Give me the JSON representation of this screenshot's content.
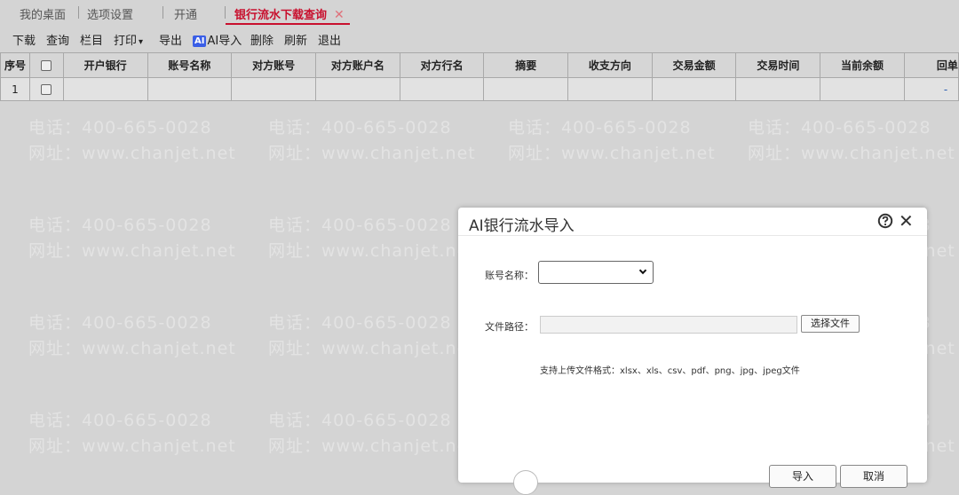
{
  "tabs": [
    {
      "label": "我的桌面"
    },
    {
      "label": "选项设置"
    },
    {
      "label": "开通"
    },
    {
      "label": "银行流水下载查询",
      "active": true
    }
  ],
  "toolbar": {
    "download": "下载",
    "query": "查询",
    "columns": "栏目",
    "print": "打印",
    "export": "导出",
    "ai_badge": "AI",
    "ai_import": "AI导入",
    "delete": "删除",
    "refresh": "刷新",
    "exit": "退出"
  },
  "grid": {
    "headers": [
      "序号",
      "",
      "开户银行",
      "账号名称",
      "对方账号",
      "对方账户名",
      "对方行名",
      "摘要",
      "收支方向",
      "交易金额",
      "交易时间",
      "当前余额",
      "回单"
    ],
    "rows": [
      {
        "index": "1",
        "last": "-"
      }
    ]
  },
  "watermark": {
    "phone": "电话：400-665-0028",
    "site": "网址：www.chanjet.net"
  },
  "dialog": {
    "title": "AI银行流水导入",
    "account_label": "账号名称：",
    "account_value": "",
    "path_label": "文件路径：",
    "path_value": "",
    "choose_file": "选择文件",
    "hint": "支持上传文件格式：xlsx、xls、csv、pdf、png、jpg、jpeg文件",
    "ok": "导入",
    "cancel": "取消"
  },
  "colors": {
    "accent": "#c8102e",
    "ai_badge": "#3a5ee6"
  }
}
